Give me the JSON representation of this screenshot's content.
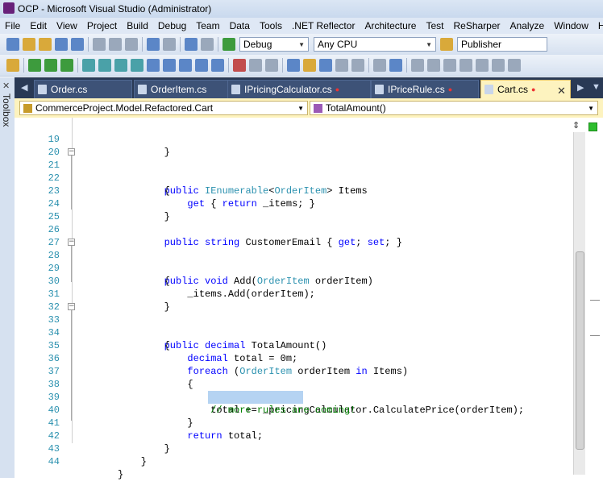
{
  "window": {
    "title": "OCP - Microsoft Visual Studio (Administrator)"
  },
  "menu": [
    "File",
    "Edit",
    "View",
    "Project",
    "Build",
    "Debug",
    "Team",
    "Data",
    "Tools",
    ".NET Reflector",
    "Architecture",
    "Test",
    "ReSharper",
    "Analyze",
    "Window",
    "Help"
  ],
  "toolbar": {
    "config": "Debug",
    "platform": "Any CPU",
    "publish": "Publisher"
  },
  "toolbox": {
    "label": "Toolbox"
  },
  "tabs": [
    {
      "label": "Order.cs",
      "modified": false,
      "active": false
    },
    {
      "label": "OrderItem.cs",
      "modified": false,
      "active": false
    },
    {
      "label": "IPricingCalculator.cs",
      "modified": true,
      "active": false
    },
    {
      "label": "IPriceRule.cs",
      "modified": true,
      "active": false
    },
    {
      "label": "Cart.cs",
      "modified": true,
      "active": true
    }
  ],
  "navbar": {
    "type": "CommerceProject.Model.Refactored.Cart",
    "member": "TotalAmount()"
  },
  "editor": {
    "lines": [
      {
        "n": "19",
        "text": "        }"
      },
      {
        "n": "20",
        "text": ""
      },
      {
        "n": "21",
        "text": "        public IEnumerable<OrderItem> Items"
      },
      {
        "n": "22",
        "text": "        {"
      },
      {
        "n": "23",
        "text": "            get { return _items; }"
      },
      {
        "n": "24",
        "text": "        }"
      },
      {
        "n": "25",
        "text": ""
      },
      {
        "n": "26",
        "text": "        public string CustomerEmail { get; set; }"
      },
      {
        "n": "27",
        "text": ""
      },
      {
        "n": "28",
        "text": "        public void Add(OrderItem orderItem)"
      },
      {
        "n": "29",
        "text": "        {"
      },
      {
        "n": "30",
        "text": "            _items.Add(orderItem);"
      },
      {
        "n": "31",
        "text": "        }"
      },
      {
        "n": "32",
        "text": ""
      },
      {
        "n": "33",
        "text": "        public decimal TotalAmount()"
      },
      {
        "n": "34",
        "text": "        {"
      },
      {
        "n": "35",
        "text": "            decimal total = 0m;"
      },
      {
        "n": "36",
        "text": "            foreach (OrderItem orderItem in Items)"
      },
      {
        "n": "37",
        "text": "            {"
      },
      {
        "n": "38",
        "text": "                total += _pricingCalculator.CalculatePrice(orderItem);"
      },
      {
        "n": "39",
        "text": "                // more rules are coming!"
      },
      {
        "n": "40",
        "text": "            }"
      },
      {
        "n": "41",
        "text": "            return total;"
      },
      {
        "n": "42",
        "text": "        }"
      },
      {
        "n": "43",
        "text": "    }"
      },
      {
        "n": "44",
        "text": "}"
      }
    ]
  },
  "colors": {
    "keyword": "#0000ff",
    "type": "#2b91af",
    "comment": "#008000",
    "line_number": "#2b91af",
    "tab_strip": "#293955",
    "active_tab": "#fdf3bf"
  }
}
